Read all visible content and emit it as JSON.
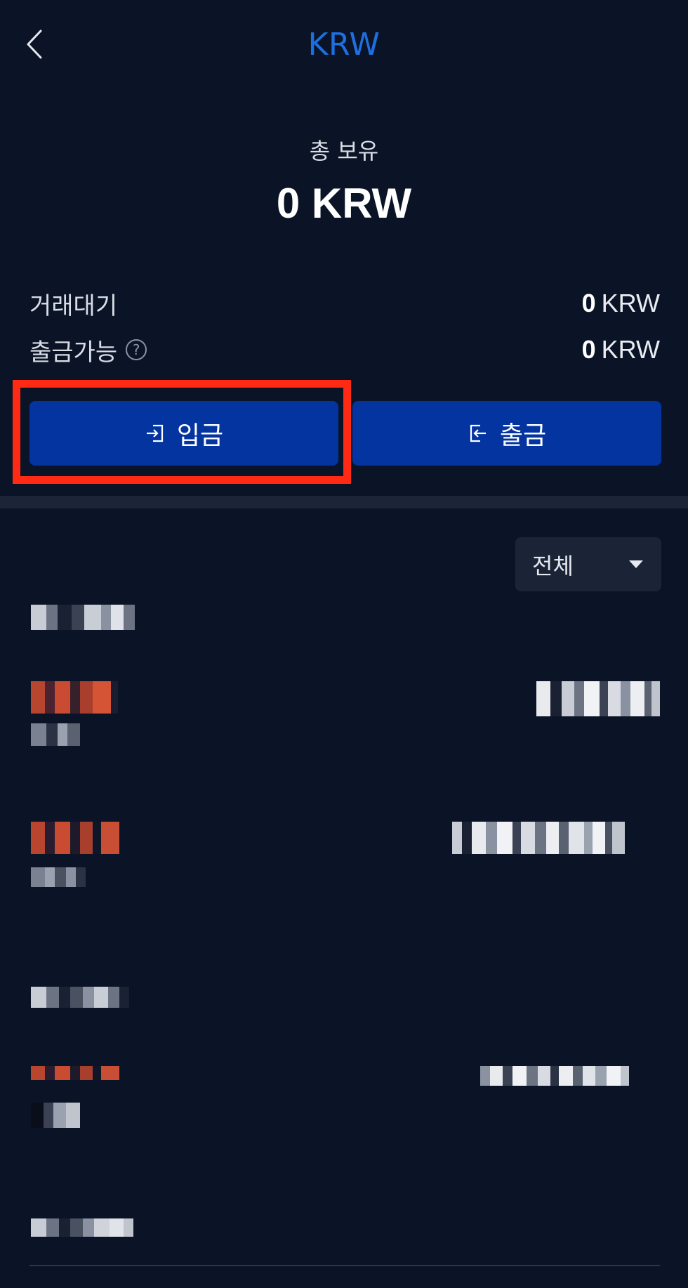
{
  "header": {
    "title": "KRW"
  },
  "summary": {
    "total_label": "총 보유",
    "total_value": "0 KRW",
    "pending_label": "거래대기",
    "pending_amount": "0",
    "pending_unit": "KRW",
    "withdrawable_label": "출금가능",
    "withdrawable_amount": "0",
    "withdrawable_unit": "KRW",
    "help_glyph": "?"
  },
  "actions": {
    "deposit_label": "입금",
    "withdraw_label": "출금"
  },
  "filter": {
    "selected": "전체"
  },
  "colors": {
    "background": "#0a1426",
    "accent": "#1e6fe0",
    "button": "#0334a0",
    "highlight": "#ff2a14"
  }
}
